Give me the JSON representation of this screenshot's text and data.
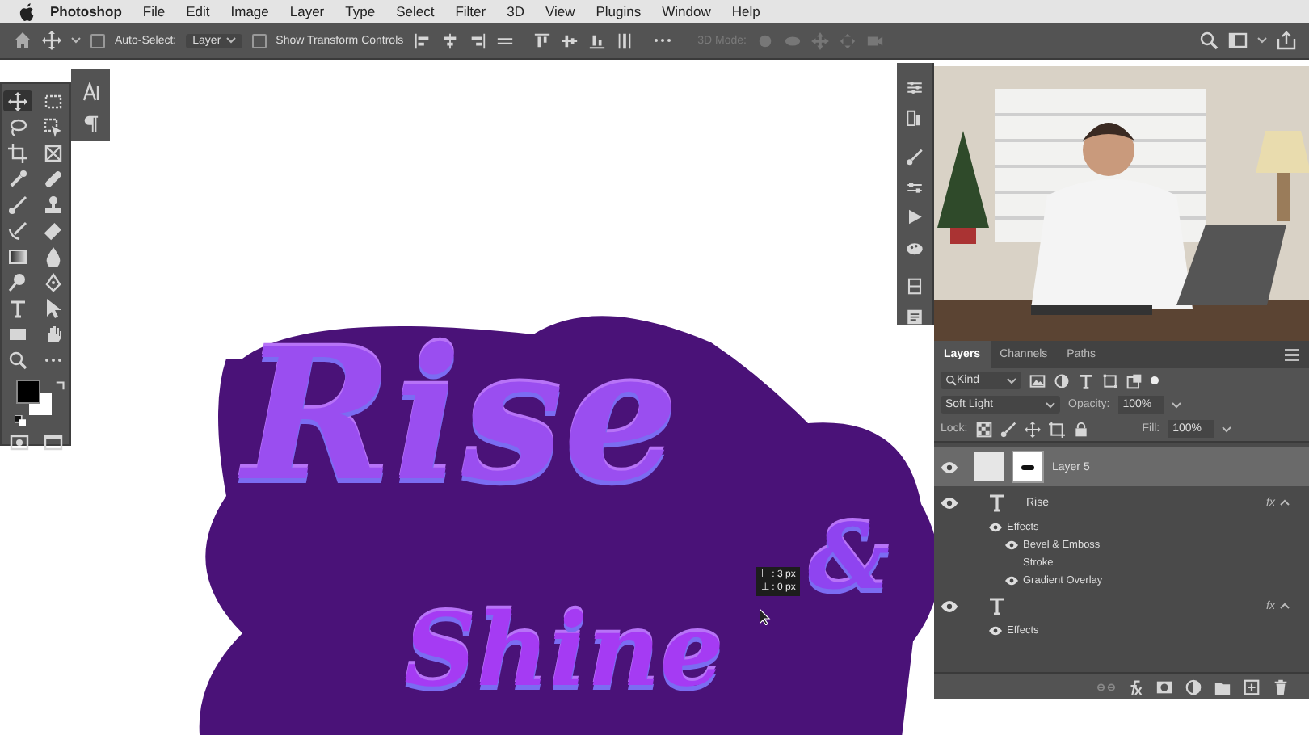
{
  "menu_bar": {
    "app": "Photoshop",
    "items": [
      "File",
      "Edit",
      "Image",
      "Layer",
      "Type",
      "Select",
      "Filter",
      "3D",
      "View",
      "Plugins",
      "Window",
      "Help"
    ]
  },
  "options_bar": {
    "auto_select": {
      "label": "Auto-Select:",
      "checked": false
    },
    "auto_select_target": "Layer",
    "transform_controls": {
      "label": "Show Transform Controls",
      "checked": false
    },
    "mode_3d": {
      "label": "3D Mode:",
      "disabled": true
    }
  },
  "tools": [
    {
      "kind": "move",
      "selected": true
    },
    {
      "kind": "marquee",
      "selected": false
    },
    {
      "kind": "lasso",
      "selected": false
    },
    {
      "kind": "object_select",
      "selected": false
    },
    {
      "kind": "crop",
      "selected": false
    },
    {
      "kind": "frame",
      "selected": false
    },
    {
      "kind": "eyedropper",
      "selected": false
    },
    {
      "kind": "healing",
      "selected": false
    },
    {
      "kind": "brush",
      "selected": false
    },
    {
      "kind": "stamp",
      "selected": false
    },
    {
      "kind": "history_brush",
      "selected": false
    },
    {
      "kind": "eraser",
      "selected": false
    },
    {
      "kind": "gradient",
      "selected": false
    },
    {
      "kind": "blur",
      "selected": false
    },
    {
      "kind": "dodge",
      "selected": false
    },
    {
      "kind": "pen",
      "selected": false
    },
    {
      "kind": "type",
      "selected": false
    },
    {
      "kind": "path_select",
      "selected": false
    },
    {
      "kind": "rectangle",
      "selected": false
    },
    {
      "kind": "hand",
      "selected": false
    },
    {
      "kind": "zoom",
      "selected": false
    },
    {
      "kind": "more",
      "selected": false
    }
  ],
  "canvas": {
    "lines": [
      "Rise",
      "&",
      "Shine"
    ],
    "tooltip": [
      "⊢ : 3 px",
      "⊥ : 0 px"
    ]
  },
  "layers_panel": {
    "tabs": [
      {
        "label": "Layers",
        "selected": true
      },
      {
        "label": "Channels",
        "selected": false
      },
      {
        "label": "Paths",
        "selected": false
      }
    ],
    "filter": "Kind",
    "blend_mode": "Soft Light",
    "opacity_label": "Opacity:",
    "opacity": "100%",
    "lock_label": "Lock:",
    "fill_label": "Fill:",
    "fill": "100%",
    "layers": [
      {
        "kind": "pixel",
        "name": "Layer 5",
        "visible": true,
        "selected": true
      },
      {
        "kind": "text",
        "name": "Rise",
        "visible": true,
        "selected": false,
        "fx": "fx",
        "effects_label": "Effects",
        "effects": [
          {
            "name": "Bevel & Emboss",
            "visible": true
          },
          {
            "name": "Stroke",
            "visible": false
          },
          {
            "name": "Gradient Overlay",
            "visible": true
          }
        ]
      },
      {
        "kind": "text",
        "visible": true,
        "selected": false,
        "fx": "fx",
        "effects_label": "Effects"
      }
    ]
  }
}
